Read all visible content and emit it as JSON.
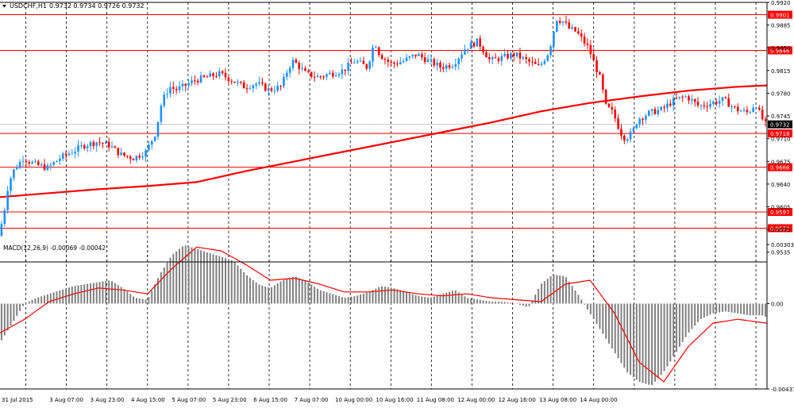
{
  "chart_data": [
    {
      "type": "candlestick",
      "symbol_header": "USDCHF,H1",
      "ohlc_header": "0.9732 0.9734 0.9726 0.9732",
      "ylim": [
        0.952,
        0.992
      ],
      "y_ticks": [
        "0.9920",
        "0.9885",
        "0.9850",
        "0.9815",
        "0.9780",
        "0.9745",
        "0.9710",
        "0.9675",
        "0.9640",
        "0.9605",
        "0.9570",
        "0.9535"
      ],
      "x_tick_labels": [
        "31 Jul 2015",
        "3 Aug 07:00",
        "3 Aug 23:00",
        "4 Aug 15:00",
        "5 Aug 07:00",
        "5 Aug 23:00",
        "6 Aug 15:00",
        "7 Aug 07:00",
        "10 Aug 00:00",
        "10 Aug 16:00",
        "11 Aug 08:00",
        "12 Aug 00:00",
        "12 Aug 16:00",
        "13 Aug 08:00",
        "14 Aug 00:00"
      ],
      "horizontal_levels": [
        {
          "label": "0.9901",
          "value": 0.9901
        },
        {
          "label": "0.9846",
          "value": 0.9846
        },
        {
          "label": "0.9718",
          "value": 0.9718
        },
        {
          "label": "0.9666",
          "value": 0.9666
        },
        {
          "label": "0.9597",
          "value": 0.9597
        },
        {
          "label": "0.9572",
          "value": 0.9572
        }
      ],
      "current_price": {
        "label": "0.9732",
        "value": 0.9732
      },
      "moving_average": {
        "x": [
          0,
          20,
          40,
          60,
          80,
          100,
          120,
          140,
          160,
          180,
          200,
          220,
          240,
          260,
          280,
          300,
          312
        ],
        "y": [
          0.962,
          0.9626,
          0.9632,
          0.9637,
          0.9643,
          0.966,
          0.9675,
          0.969,
          0.9705,
          0.972,
          0.9735,
          0.9752,
          0.9765,
          0.9775,
          0.9784,
          0.979,
          0.9792
        ]
      },
      "price_path": {
        "x": [
          0,
          2,
          4,
          6,
          10,
          15,
          20,
          25,
          30,
          35,
          40,
          45,
          50,
          55,
          60,
          64,
          66,
          68,
          70,
          72,
          75,
          80,
          85,
          90,
          95,
          100,
          105,
          110,
          115,
          118,
          120,
          125,
          130,
          135,
          140,
          145,
          150,
          153,
          155,
          158,
          160,
          165,
          170,
          175,
          180,
          185,
          190,
          195,
          200,
          205,
          210,
          215,
          220,
          224,
          227,
          230,
          232,
          235,
          240,
          245,
          247,
          250,
          253,
          255,
          258,
          260,
          265,
          270,
          275,
          280,
          285,
          290,
          295,
          300,
          305,
          308,
          310,
          312
        ],
        "y": [
          0.956,
          0.959,
          0.964,
          0.966,
          0.968,
          0.967,
          0.9665,
          0.968,
          0.969,
          0.97,
          0.9705,
          0.97,
          0.9685,
          0.968,
          0.969,
          0.972,
          0.976,
          0.978,
          0.979,
          0.9785,
          0.979,
          0.98,
          0.9805,
          0.981,
          0.98,
          0.979,
          0.9795,
          0.9785,
          0.979,
          0.982,
          0.983,
          0.981,
          0.9805,
          0.981,
          0.9815,
          0.983,
          0.982,
          0.986,
          0.984,
          0.983,
          0.9825,
          0.983,
          0.984,
          0.983,
          0.982,
          0.9825,
          0.985,
          0.986,
          0.983,
          0.9835,
          0.984,
          0.983,
          0.982,
          0.9845,
          0.9895,
          0.989,
          0.988,
          0.9875,
          0.985,
          0.98,
          0.976,
          0.975,
          0.972,
          0.971,
          0.972,
          0.974,
          0.975,
          0.9755,
          0.977,
          0.9775,
          0.976,
          0.9765,
          0.977,
          0.9755,
          0.975,
          0.9765,
          0.9745,
          0.9732
        ]
      }
    },
    {
      "type": "histogram",
      "header": "MACD(12,26,9) -0.00069 -0.00042",
      "ylim": [
        -0.00437,
        0.00303
      ],
      "y_ticks": [
        "0.00303",
        "0.00",
        "-0.00437"
      ],
      "histogram": {
        "x": [
          0,
          5,
          10,
          15,
          20,
          25,
          30,
          35,
          40,
          45,
          50,
          55,
          60,
          65,
          70,
          75,
          80,
          85,
          90,
          95,
          100,
          105,
          110,
          115,
          120,
          125,
          130,
          135,
          140,
          145,
          150,
          155,
          160,
          165,
          170,
          175,
          180,
          185,
          190,
          195,
          200,
          205,
          210,
          215,
          220,
          225,
          230,
          235,
          240,
          245,
          250,
          255,
          260,
          265,
          270,
          275,
          280,
          285,
          290,
          295,
          300,
          305,
          310,
          312
        ],
        "y": [
          -0.002,
          -0.001,
          0.0,
          0.0003,
          0.0005,
          0.0007,
          0.0009,
          0.001,
          0.0011,
          0.0012,
          0.0008,
          0.0003,
          0.0002,
          0.0015,
          0.0025,
          0.003,
          0.0028,
          0.0026,
          0.0024,
          0.0022,
          0.0015,
          0.001,
          0.0008,
          0.0012,
          0.0014,
          0.0011,
          0.0007,
          0.0005,
          0.0003,
          0.0004,
          0.0006,
          0.0009,
          0.0008,
          0.0006,
          0.0004,
          0.0003,
          0.0005,
          0.0007,
          0.0003,
          0.0002,
          0.0001,
          0.0001,
          0.0,
          -0.0002,
          0.001,
          0.0015,
          0.0014,
          0.0005,
          -0.0005,
          -0.0015,
          -0.0025,
          -0.0035,
          -0.004,
          -0.0042,
          -0.0035,
          -0.0025,
          -0.0015,
          -0.0008,
          -0.0005,
          -0.0004,
          -0.0005,
          -0.0006,
          -0.0006,
          -0.0007
        ]
      },
      "signal_line": {
        "x": [
          0,
          10,
          20,
          30,
          40,
          50,
          60,
          70,
          80,
          90,
          100,
          110,
          120,
          130,
          140,
          150,
          160,
          170,
          180,
          190,
          200,
          210,
          220,
          230,
          240,
          250,
          260,
          270,
          280,
          290,
          300,
          312
        ],
        "y": [
          -0.0015,
          -0.0008,
          0.0001,
          0.0005,
          0.0008,
          0.0007,
          0.0005,
          0.0018,
          0.0029,
          0.0027,
          0.002,
          0.0012,
          0.0013,
          0.001,
          0.0006,
          0.0006,
          0.0007,
          0.0005,
          0.0004,
          0.0005,
          0.0003,
          0.0002,
          0.0001,
          0.001,
          0.0012,
          -0.0005,
          -0.003,
          -0.004,
          -0.0022,
          -0.001,
          -0.0008,
          -0.001
        ]
      }
    }
  ],
  "colors": {
    "bull_candle": "#1e90ff",
    "bear_candle": "#ff0000",
    "moving_average": "#ff0000",
    "levels": "#ff0000",
    "level_label_bg": "#ff0000",
    "current_price_bg": "#000000",
    "macd_histogram": "#808080",
    "macd_signal": "#ff0000",
    "grid": "#000000",
    "axis_text": "#000000"
  }
}
